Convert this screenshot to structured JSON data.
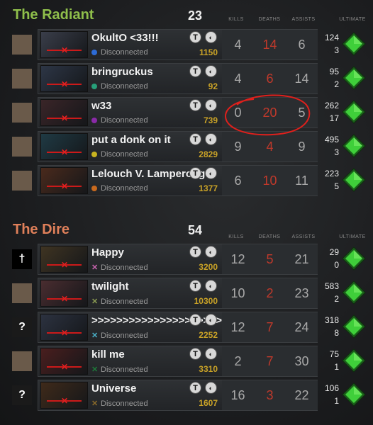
{
  "radiant": {
    "name": "The Radiant",
    "score": "23",
    "color": "#8fbf4b",
    "headers": {
      "kills": "KILLS",
      "deaths": "DEATHS",
      "assists": "ASSISTS",
      "ultimate": "ULTIMATE"
    },
    "players": [
      {
        "avatar": "",
        "name": "OkultO <33!!!",
        "status": "Disconnected",
        "dot": "#2d6bd6",
        "gold": "1150",
        "kills": "4",
        "deaths": "14",
        "assists": "6",
        "nw_top": "124",
        "nw_bot": "3",
        "portrait": "#3a3e4a"
      },
      {
        "avatar": "",
        "name": "bringruckus",
        "status": "Disconnected",
        "dot": "#27a07a",
        "gold": "92",
        "kills": "4",
        "deaths": "6",
        "assists": "14",
        "nw_top": "95",
        "nw_bot": "2",
        "portrait": "#2d3646"
      },
      {
        "avatar": "",
        "name": "w33",
        "status": "Disconnected",
        "dot": "#8a2aa8",
        "gold": "739",
        "kills": "0",
        "deaths": "20",
        "assists": "5",
        "nw_top": "262",
        "nw_bot": "17",
        "portrait": "#3a2528"
      },
      {
        "avatar": "",
        "name": "put a donk on it",
        "status": "Disconnected",
        "dot": "#c9b420",
        "gold": "2829",
        "kills": "9",
        "deaths": "4",
        "assists": "9",
        "nw_top": "495",
        "nw_bot": "3",
        "portrait": "#1f3a44"
      },
      {
        "avatar": "",
        "name": "Lelouch V. Lamperouge",
        "status": "Disconnected",
        "dot": "#c96a1e",
        "gold": "1377",
        "kills": "6",
        "deaths": "10",
        "assists": "11",
        "nw_top": "223",
        "nw_bot": "5",
        "portrait": "#4a2a1c"
      }
    ]
  },
  "dire": {
    "name": "The Dire",
    "score": "54",
    "color": "#e0805a",
    "headers": {
      "kills": "KILLS",
      "deaths": "DEATHS",
      "assists": "ASSISTS",
      "ultimate": "ULTIMATE"
    },
    "players": [
      {
        "avatar": "†",
        "name": "Happy",
        "status": "Disconnected",
        "xcolor": "#c966b0",
        "gold": "3200",
        "kills": "12",
        "deaths": "5",
        "assists": "21",
        "nw_top": "29",
        "nw_bot": "0",
        "portrait": "#3f3422"
      },
      {
        "avatar": "",
        "name": "twilight",
        "status": "Disconnected",
        "xcolor": "#8a9a52",
        "gold": "10300",
        "kills": "10",
        "deaths": "2",
        "assists": "23",
        "nw_top": "583",
        "nw_bot": "2",
        "portrait": "#4a2d30"
      },
      {
        "avatar": "?",
        "name": ">>>>>>>>>>>>>>>>>>>>>>",
        "status": "Disconnected",
        "xcolor": "#4ab0c8",
        "gold": "2252",
        "kills": "12",
        "deaths": "7",
        "assists": "24",
        "nw_top": "318",
        "nw_bot": "8",
        "portrait": "#2c3240"
      },
      {
        "avatar": "",
        "name": "kill me",
        "status": "Disconnected",
        "xcolor": "#1e7a3a",
        "gold": "3310",
        "kills": "2",
        "deaths": "7",
        "assists": "30",
        "nw_top": "75",
        "nw_bot": "1",
        "portrait": "#4a1e1e"
      },
      {
        "avatar": "?",
        "name": "Universe",
        "status": "Disconnected",
        "xcolor": "#8a6a2a",
        "gold": "1607",
        "kills": "16",
        "deaths": "3",
        "assists": "22",
        "nw_top": "106",
        "nw_bot": "1",
        "portrait": "#3f2a1a"
      }
    ]
  },
  "icons": {
    "tip": "T",
    "voice": "◐"
  },
  "colors": {
    "gold": "#c9a227",
    "deaths": "#c0392b",
    "ultimate": "#3fcf3a",
    "annotation": "#e0201c"
  }
}
